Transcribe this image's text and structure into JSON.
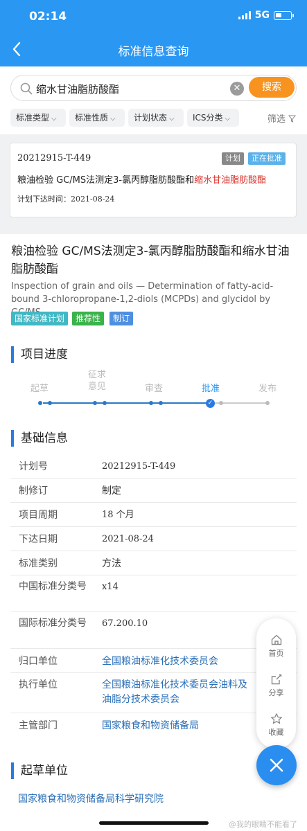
{
  "status_bar": {
    "time": "02:14",
    "network": "5G"
  },
  "nav": {
    "title": "标准信息查询"
  },
  "search": {
    "query": "缩水甘油脂肪酸酯",
    "button": "搜索"
  },
  "filters": {
    "chips": [
      "标准类型",
      "标准性质",
      "计划状态",
      "ICS分类"
    ],
    "right_label": "筛选"
  },
  "result_card": {
    "code": "20212915-T-449",
    "badge_plan": "计划",
    "badge_status": "正在批准",
    "title_prefix": "粮油检验 GC/MS法测定3-氯丙醇脂肪酸酯和",
    "title_highlight": "缩水甘油脂肪酸酯",
    "date_label": "计划下达时间：",
    "date_value": "2021-08-24"
  },
  "standard": {
    "title": "粮油检验 GC/MS法测定3-氯丙醇脂肪酸酯和缩水甘油脂肪酸酯",
    "title_en": "Inspection of grain and oils — Determination of fatty-acid-bound 3-chloropropane-1,2-diols (MCPDs) and glycidol by GC/MS",
    "tags": [
      {
        "label": "国家标准计划",
        "color": "#41b8c4"
      },
      {
        "label": "推荐性",
        "color": "#39b34a"
      },
      {
        "label": "制订",
        "color": "#4f8fe0"
      }
    ]
  },
  "progress": {
    "title": "项目进度",
    "steps": [
      {
        "label": "起草"
      },
      {
        "label": "征求\n意见"
      },
      {
        "label": "审查"
      },
      {
        "label": "批准",
        "active": true
      },
      {
        "label": "发布"
      }
    ]
  },
  "basic_info": {
    "title": "基础信息",
    "rows": [
      {
        "key": "计划号",
        "value": "20212915-T-449"
      },
      {
        "key": "制修订",
        "value": "制定"
      },
      {
        "key": "项目周期",
        "value": "18 个月"
      },
      {
        "key": "下达日期",
        "value": "2021-08-24"
      },
      {
        "key": "标准类别",
        "value": "方法"
      },
      {
        "key": "中国标准分类号",
        "value": "x14"
      },
      {
        "key": "国际标准分类号",
        "value": "67.200.10"
      },
      {
        "key": "归口单位",
        "value": "全国粮油标准化技术委员会"
      },
      {
        "key": "执行单位",
        "value": "全国粮油标准化技术委员会油料及油脂分技术委员会"
      },
      {
        "key": "主管部门",
        "value": "国家粮食和物资储备局"
      }
    ]
  },
  "drafting": {
    "title": "起草单位",
    "unit": "国家粮食和物资储备局科学研究院"
  },
  "float_menu": {
    "home": "首页",
    "share": "分享",
    "favorite": "收藏"
  },
  "watermark": "@我的眼睛不能看了"
}
